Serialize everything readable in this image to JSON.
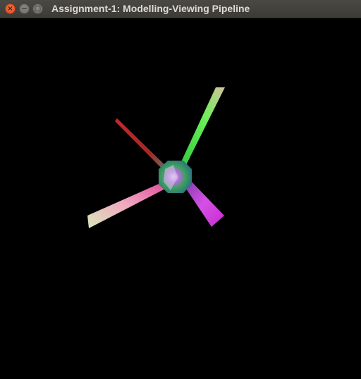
{
  "window": {
    "title": "Assignment-1: Modelling-Viewing Pipeline",
    "close_glyph": "×",
    "minimize_glyph": "−",
    "maximize_glyph": "□"
  },
  "canvas": {
    "background": "#000000",
    "objects": [
      {
        "name": "central-octagon",
        "colors": [
          "#2f7a86",
          "#3d9c5a",
          "#9a6bd8",
          "#d8c0e0"
        ]
      },
      {
        "name": "green-arm",
        "colors": [
          "#4de84a",
          "#b6e0b0"
        ]
      },
      {
        "name": "magenta-arm",
        "colors": [
          "#e04ae0",
          "#8a2aa0"
        ]
      },
      {
        "name": "pink-arm",
        "colors": [
          "#f08aa8",
          "#d0e0b0"
        ]
      },
      {
        "name": "red-arm",
        "colors": [
          "#c02828",
          "#5a8a80"
        ]
      }
    ]
  }
}
